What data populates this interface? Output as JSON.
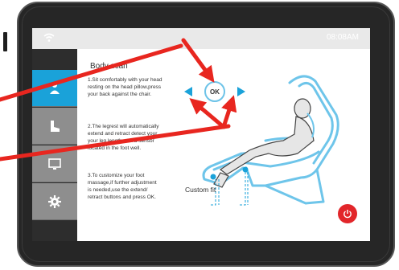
{
  "status_bar": {
    "time": "08:08AM",
    "wifi_icon": "wifi-icon"
  },
  "sidebar": {
    "items": [
      {
        "icon": "person-icon",
        "active": true
      },
      {
        "icon": "foot-icon",
        "active": false
      },
      {
        "icon": "monitor-icon",
        "active": false
      },
      {
        "icon": "gear-icon",
        "active": false
      }
    ]
  },
  "content": {
    "title": "Body scan",
    "step1": [
      "1.Sit comfortably with your head",
      "resting on the head pillow,press",
      "your back against the chair."
    ],
    "step2": [
      "2.The legrest will automatically",
      "extend and retract detect your",
      "your leg length with a sensor",
      "located in the foot well."
    ],
    "step3": [
      "3.To customize your foot",
      "massage,if further adjustment",
      "is needed,use the extend/",
      "retract buttons and press OK."
    ],
    "custom_fit_label": "Custom fit"
  },
  "controls": {
    "ok_label": "OK",
    "power_icon": "power-icon",
    "left_icon": "left-triangle-icon",
    "right_icon": "right-triangle-icon"
  },
  "colors": {
    "accent": "#1aa2d9",
    "sidebar_bg": "#8e8e8e",
    "arrow_red": "#e8261f",
    "power_red": "#e2262a",
    "chair_blue": "#6ec5ea"
  }
}
